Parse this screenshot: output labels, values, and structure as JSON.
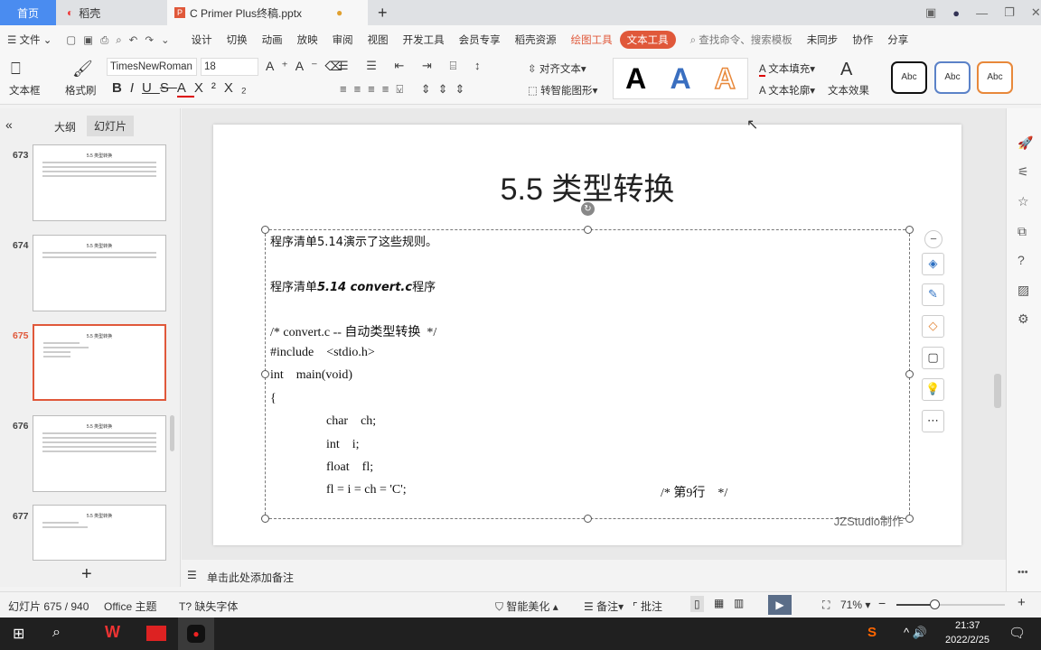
{
  "tabs": {
    "home": "首页",
    "daoke": "稻壳",
    "document": "C Primer  Plus终稿.pptx",
    "new_tab": "+"
  },
  "menu": {
    "file": "文件",
    "items": [
      "设计",
      "切换",
      "动画",
      "放映",
      "审阅",
      "视图",
      "开发工具",
      "会员专享",
      "稻壳资源"
    ],
    "drawing_tools": "绘图工具",
    "text_tools": "文本工具",
    "search": "查找命令、搜索模板",
    "sync": "未同步",
    "collab": "协作",
    "share": "分享"
  },
  "toolbar": {
    "textbox": "文本框",
    "format_painter": "格式刷",
    "font": "TimesNewRoman",
    "size": "18",
    "align_text": "对齐文本",
    "smart_art": "转智能图形",
    "text_fill": "文本填充",
    "text_outline": "文本轮廓",
    "text_effect": "文本效果",
    "style_sample": "Abc",
    "big_a": "A"
  },
  "left_panel": {
    "outline_tab": "大纲",
    "slides_tab": "幻灯片",
    "slides": [
      {
        "num": "673",
        "title": "5.5 类型转换"
      },
      {
        "num": "674",
        "title": "5.5 类型转换"
      },
      {
        "num": "675",
        "title": "5.5 类型转换"
      },
      {
        "num": "676",
        "title": "5.5 类型转换"
      },
      {
        "num": "677",
        "title": "5.5 类型转换"
      }
    ],
    "add": "+"
  },
  "slide": {
    "title": "5.5 类型转换",
    "lines": [
      "程序清单5.14演示了这些规则。",
      "程序清单",
      "5.14 convert.c",
      "程序",
      "/* convert.c -- 自动类型转换  */",
      "#include    <stdio.h>",
      "int    main(void)",
      "{",
      "char    ch;",
      "int    i;",
      "float    fl;",
      "fl = i = ch = 'C';",
      "/* 第9行    */"
    ],
    "watermark": "JZStudio制作"
  },
  "notes": {
    "placeholder": "单击此处添加备注"
  },
  "status": {
    "slide_counter": "幻灯片 675 / 940",
    "theme": "Office 主题",
    "missing_font": "缺失字体",
    "beautify": "智能美化",
    "notes": "备注",
    "comments": "批注",
    "zoom": "71%"
  },
  "taskbar": {
    "time": "21:37",
    "date": "2022/2/25"
  }
}
